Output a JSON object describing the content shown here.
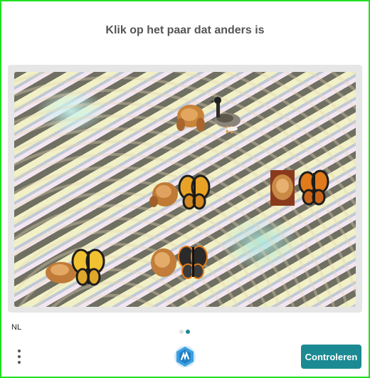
{
  "prompt": "Klik op het paar dat anders is",
  "language": "NL",
  "pagination": {
    "total": 2,
    "current": 2
  },
  "submit_label": "Controleren",
  "pairs": [
    {
      "id": "pair-1",
      "items": [
        "chicken-icon",
        "goose-icon"
      ]
    },
    {
      "id": "pair-2",
      "items": [
        "chicken-icon",
        "butterfly-icon"
      ]
    },
    {
      "id": "pair-3",
      "items": [
        "chicken-icon",
        "butterfly-icon"
      ]
    },
    {
      "id": "pair-4",
      "items": [
        "butterfly-icon",
        "chicken-icon"
      ]
    },
    {
      "id": "pair-5",
      "items": [
        "chicken-icon",
        "butterfly-icon"
      ]
    }
  ],
  "colors": {
    "accent": "#1b8a93",
    "frame": "#22e022",
    "title": "#555555"
  }
}
